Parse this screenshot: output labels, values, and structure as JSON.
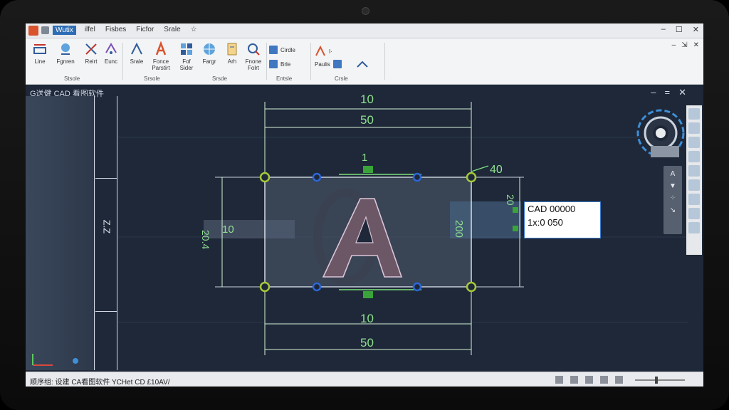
{
  "titlebar": {
    "tabs": [
      "Wutix",
      "ilfel",
      "Fisbes",
      "Ficfor",
      "Srale",
      "☆"
    ],
    "active_tab": "Wutix",
    "controls": [
      "–",
      "☐",
      "✕"
    ],
    "ribbon_controls": [
      "–",
      "⇲",
      "✕"
    ]
  },
  "ribbon": {
    "tools": [
      {
        "label": "Line"
      },
      {
        "label": "Fgnren"
      },
      {
        "label": "Reirt"
      },
      {
        "label": "Eunc"
      },
      {
        "label": "Fonce Parstirt"
      },
      {
        "label": "Fof Sider"
      },
      {
        "label": "Fargr"
      },
      {
        "label": "Arh"
      },
      {
        "label": "Fnone Folrt"
      }
    ],
    "small_tools": [
      "Cirdle",
      "Brle",
      "Paulis"
    ],
    "group_labels": [
      "Stsole",
      "Srsole",
      "Srsde",
      "Entsle",
      "Crsle"
    ]
  },
  "document": {
    "tab_title": "G送健 CAD 看图软件",
    "controls": [
      "–",
      "=",
      "✕"
    ]
  },
  "left_panel": {
    "vertical_label": "Z.Z",
    "arrow": "⊤"
  },
  "drawing": {
    "dim_top_inner": "10",
    "dim_top_outer": "50",
    "dim_top_small": "1",
    "dim_right_top": "40",
    "dim_bottom_inner": "10",
    "dim_bottom_outer": "50",
    "dim_left_rotated": "20.4",
    "dim_left_value": "10",
    "dim_mid_rotated": "200",
    "dim_right_rotated": "20",
    "letter": "A"
  },
  "tooltip": {
    "line1": "CAD 00000",
    "line2": "1x:0 050"
  },
  "navbar": {
    "items": [
      "A",
      "▼",
      "⁘",
      "↘"
    ]
  },
  "status": {
    "text": "顺序组: 设建 CA看图软件  YCHet CD £10AV/"
  },
  "colors": {
    "canvas": "#1e2838",
    "dimension": "#8fe08f",
    "grip_green": "#a4c83a",
    "grip_blue": "#2b66d9",
    "letter_fill": "#6c5767",
    "ribbon": "#f3f4f6"
  }
}
